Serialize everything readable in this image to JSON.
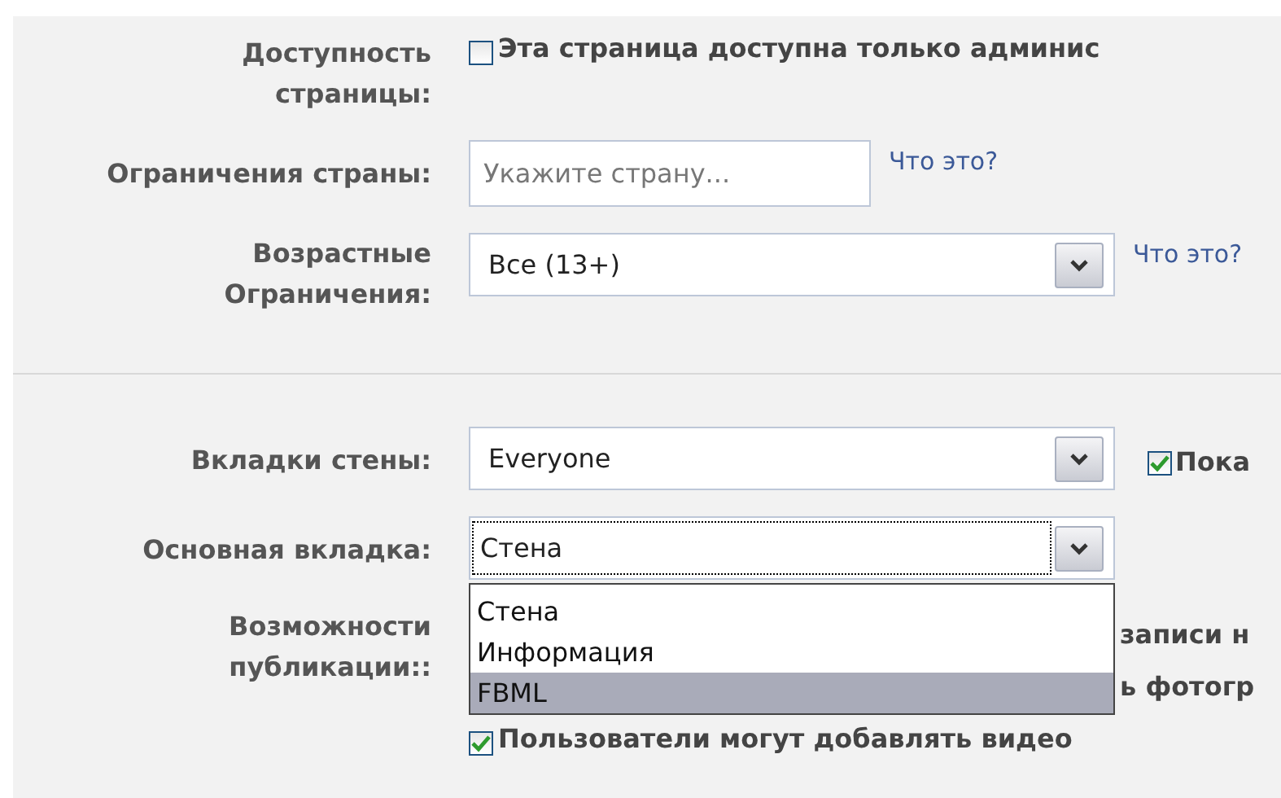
{
  "sections": [
    {
      "fields": [
        {
          "kind": "checkbox",
          "label_lines": [
            "Доступность",
            "страницы:"
          ],
          "checked": false,
          "text": "Эта страница доступна только админис"
        },
        {
          "kind": "text_input",
          "label_lines": [
            "Ограничения страны:"
          ],
          "placeholder": "Укажите страну...",
          "link": "Что это?"
        },
        {
          "kind": "select",
          "label_lines": [
            "Возрастные",
            "Ограничения:"
          ],
          "value": "Все (13+)",
          "link": "Что это?"
        }
      ]
    },
    {
      "fields": [
        {
          "kind": "select",
          "label_lines": [
            "Вкладки стены:"
          ],
          "value": "Everyone",
          "checkbox": {
            "checked": true,
            "text": "Пока"
          }
        },
        {
          "kind": "select",
          "label_lines": [
            "Основная вкладка:"
          ],
          "value": "Стена",
          "focused": true,
          "options": [
            {
              "label": "Стена",
              "highlighted": false
            },
            {
              "label": "Информация",
              "highlighted": false
            },
            {
              "label": "FBML",
              "highlighted": true
            }
          ]
        },
        {
          "kind": "checklist",
          "label_lines": [
            "Возможности",
            "публикации::"
          ],
          "items": [
            {
              "kind": "partial",
              "text": "записи н"
            },
            {
              "kind": "partial",
              "text": "ь фотогр"
            },
            {
              "kind": "checkbox",
              "checked": true,
              "text": "Пользователи могут добавлять видео"
            }
          ]
        }
      ]
    }
  ]
}
